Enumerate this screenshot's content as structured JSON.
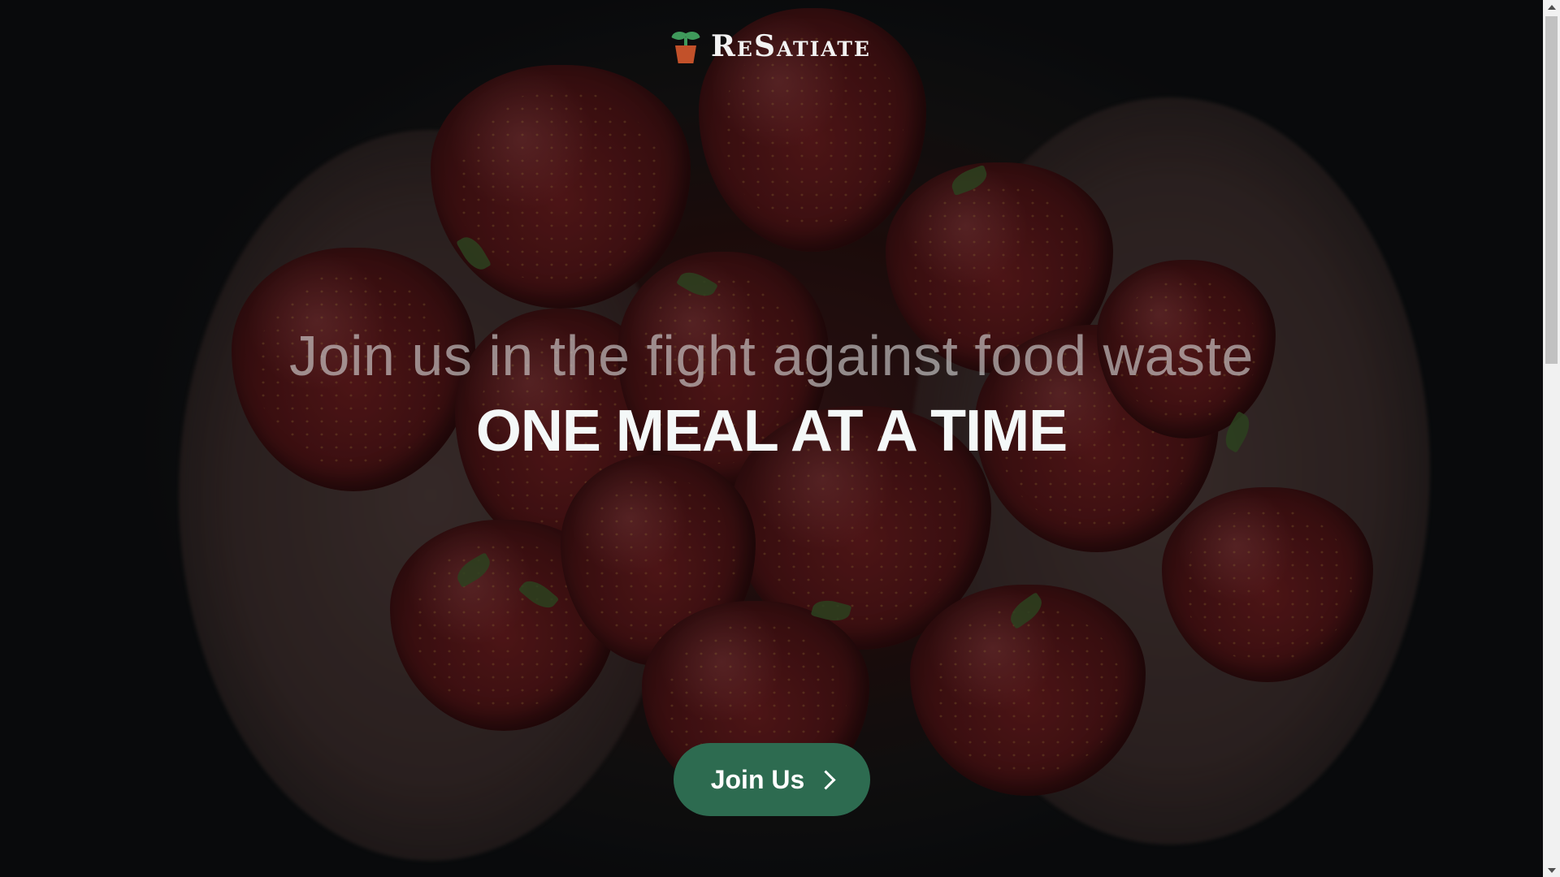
{
  "brand": {
    "name": "ReSatiate",
    "icon": "potted-sprout-icon"
  },
  "hero": {
    "headline": "Join us in the fight against food waste",
    "subheadline": "ONE MEAL AT A TIME"
  },
  "cta": {
    "label": "Join Us",
    "icon": "chevron-right-icon",
    "color": "#2d6b50"
  },
  "colors": {
    "brand_green": "#3f9a5b",
    "pot_orange": "#c2512a"
  }
}
